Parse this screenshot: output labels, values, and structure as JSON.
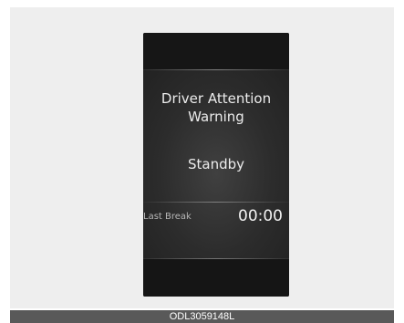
{
  "display": {
    "title_line1": "Driver Attention",
    "title_line2": "Warning",
    "status": "Standby",
    "last_break_label": "Last Break",
    "last_break_value": "00:00"
  },
  "caption": "ODL3059148L"
}
